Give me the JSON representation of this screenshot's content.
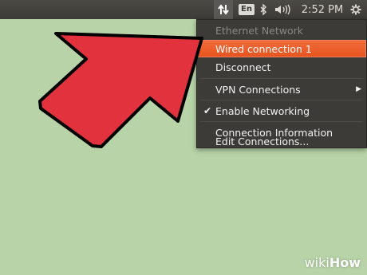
{
  "panel": {
    "keyboard_layout": "En",
    "clock": "2:52 PM",
    "icons": [
      "network-transfer-icon",
      "bluetooth-icon",
      "volume-icon",
      "gear-icon"
    ]
  },
  "network_menu": {
    "section_header": "Ethernet Network",
    "items": [
      {
        "label": "Wired connection 1",
        "highlighted": true
      },
      {
        "label": "Disconnect"
      },
      {
        "label": "VPN Connections",
        "submenu": true
      },
      {
        "label": "Enable Networking",
        "checked": true
      },
      {
        "label": "Connection Information"
      },
      {
        "label": "Edit Connections..."
      }
    ],
    "highlight_color": "#e9541f"
  },
  "annotation": {
    "arrow_color": "#e2323e",
    "arrow_outline": "#000000"
  },
  "watermark": {
    "prefix": "wiki",
    "suffix": "How"
  }
}
